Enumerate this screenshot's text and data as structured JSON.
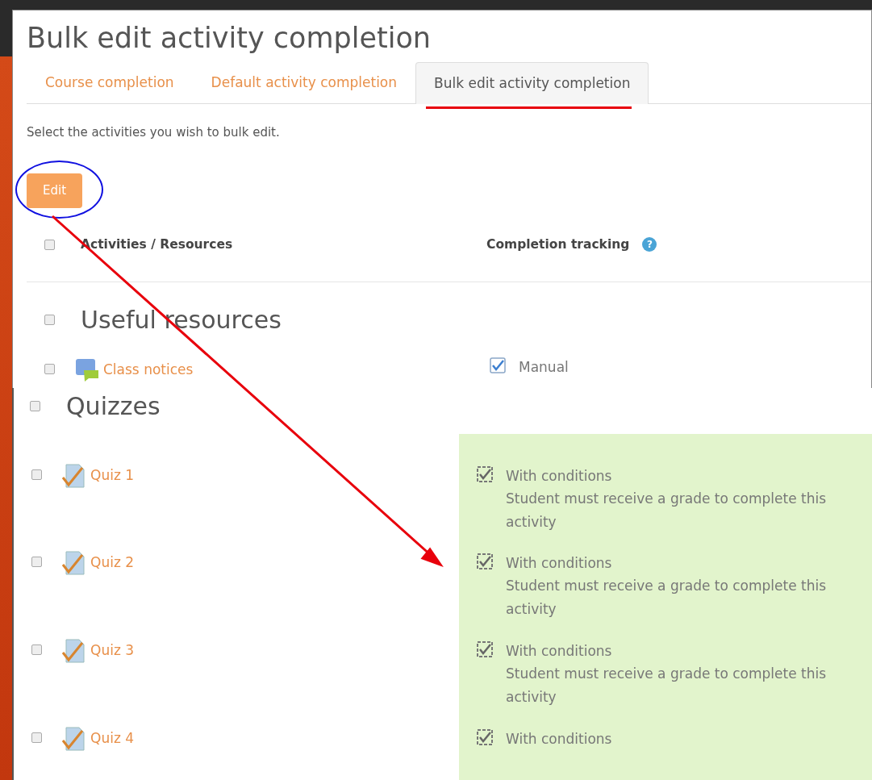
{
  "page": {
    "title": "Bulk edit activity completion"
  },
  "tabs": [
    {
      "label": "Course completion",
      "selected": false
    },
    {
      "label": "Default activity completion",
      "selected": false
    },
    {
      "label": "Bulk edit activity completion",
      "selected": true
    }
  ],
  "intro": "Select the activities you wish to bulk edit.",
  "edit_button": "Edit",
  "table": {
    "select_all_checked": false,
    "columns": [
      "Activities / Resources",
      "Completion tracking"
    ],
    "help_icon": "?"
  },
  "sections": [
    {
      "name": "Useful resources",
      "checked": false,
      "activities": [
        {
          "name": "Class notices",
          "kind": "forum",
          "checked": false,
          "highlighted": false,
          "tracking": {
            "kind": "manual",
            "checked": true,
            "label": "Manual"
          }
        }
      ]
    },
    {
      "name": "Quizzes",
      "checked": false,
      "activities": [
        {
          "name": "Quiz 1",
          "kind": "quiz",
          "checked": false,
          "highlighted": true,
          "tracking": {
            "kind": "conditions",
            "checked": true,
            "label": "With conditions",
            "details": [
              "Student must receive a grade to complete this activity"
            ]
          }
        },
        {
          "name": "Quiz 2",
          "kind": "quiz",
          "checked": false,
          "highlighted": true,
          "tracking": {
            "kind": "conditions",
            "checked": true,
            "label": "With conditions",
            "details": [
              "Student must receive a grade to complete this activity"
            ]
          }
        },
        {
          "name": "Quiz 3",
          "kind": "quiz",
          "checked": false,
          "highlighted": true,
          "tracking": {
            "kind": "conditions",
            "checked": true,
            "label": "With conditions",
            "details": [
              "Student must receive a grade to complete this activity"
            ]
          }
        },
        {
          "name": "Quiz 4",
          "kind": "quiz",
          "checked": false,
          "highlighted": true,
          "tracking": {
            "kind": "conditions",
            "checked": true,
            "label": "With conditions"
          }
        }
      ]
    }
  ]
}
